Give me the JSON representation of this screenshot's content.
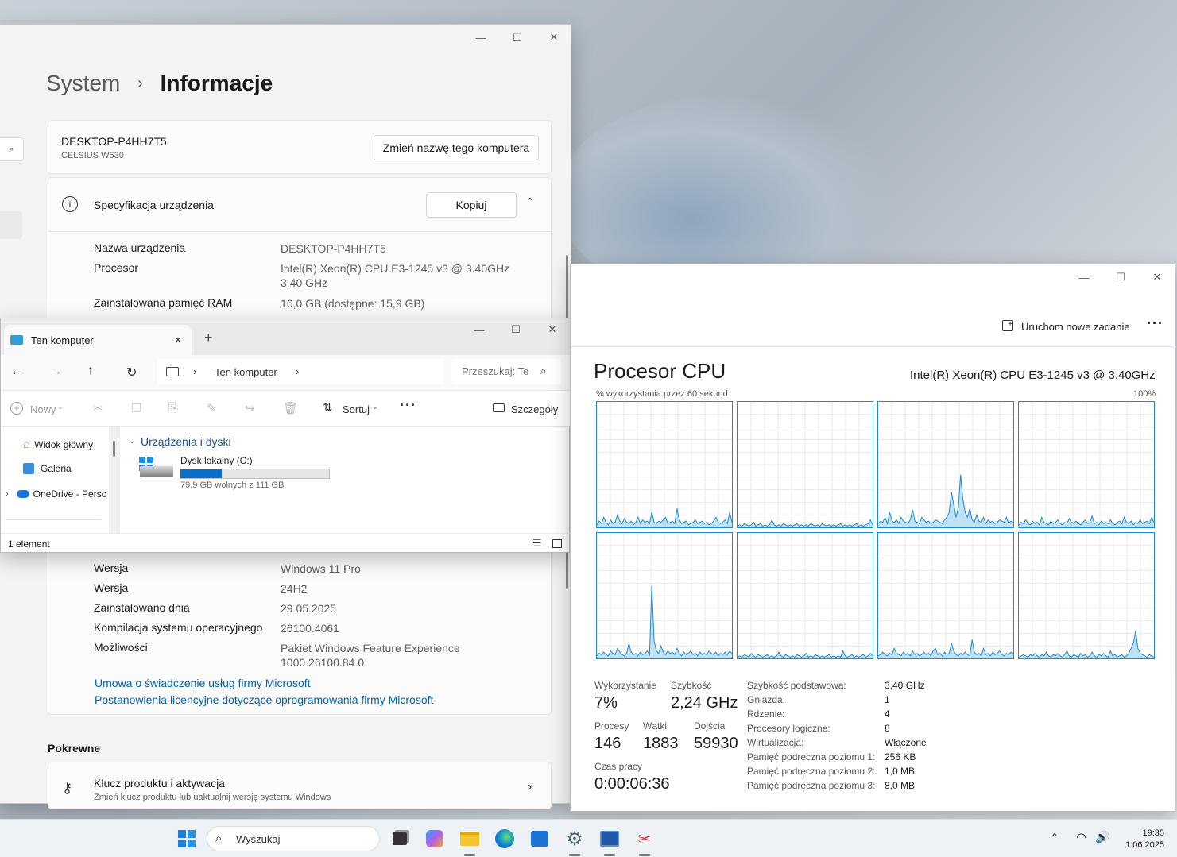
{
  "settings": {
    "breadcrumb_parent": "System",
    "breadcrumb_sep": "›",
    "title": "Informacje",
    "computer_name": "DESKTOP-P4HH7T5",
    "computer_model": "CELSIUS W530",
    "rename_button": "Zmień nazwę tego komputera",
    "spec_section_title": "Specyfikacja urządzenia",
    "copy_button": "Kopiuj",
    "device_specs": [
      {
        "key": "Nazwa urządzenia",
        "value": "DESKTOP-P4HH7T5"
      },
      {
        "key": "Procesor",
        "value": "Intel(R) Xeon(R) CPU E3-1245 v3 @ 3.40GHz",
        "value2": "3.40 GHz"
      },
      {
        "key": "Zainstalowana pamięć RAM",
        "value": "16,0 GB (dostępne: 15,9 GB)"
      }
    ],
    "windows_specs": [
      {
        "key": "Wersja",
        "value": "Windows 11 Pro"
      },
      {
        "key": "Wersja",
        "value": "24H2"
      },
      {
        "key": "Zainstalowano dnia",
        "value": "29.05.2025"
      },
      {
        "key": "Kompilacja systemu operacyjnego",
        "value": "26100.4061"
      },
      {
        "key": "Możliwości",
        "value": "Pakiet Windows Feature Experience",
        "value2": "1000.26100.84.0"
      }
    ],
    "link_services": "Umowa o świadczenie usług firmy Microsoft",
    "link_license": "Postanowienia licencyjne dotyczące oprogramowania firmy Microsoft",
    "related_heading": "Pokrewne",
    "product_key_title": "Klucz produktu i aktywacja",
    "product_key_desc": "Zmień klucz produktu lub uaktualnij wersję systemu Windows"
  },
  "explorer": {
    "tab_title": "Ten komputer",
    "breadcrumb": "Ten komputer",
    "search_placeholder": "Przeszukaj: Te",
    "cmd_new": "Nowy",
    "cmd_sort": "Sortuj",
    "cmd_details": "Szczegóły",
    "nav_items": [
      "Widok główny",
      "Galeria",
      "OneDrive - Perso"
    ],
    "group_title": "Urządzenia i dyski",
    "drive_name": "Dysk lokalny (C:)",
    "drive_free_text": "79,9 GB wolnych z 111 GB",
    "drive_used_fraction": 0.28,
    "status": "1 element"
  },
  "taskman": {
    "new_task": "Uruchom nowe zadanie",
    "heading": "Procesor CPU",
    "cpu_model": "Intel(R) Xeon(R) CPU E3-1245 v3 @ 3.40GHz",
    "graph_caption": "% wykorzystania przez 60 sekund",
    "graph_max": "100%",
    "stats": {
      "util_label": "Wykorzystanie",
      "util_value": "7%",
      "speed_label": "Szybkość",
      "speed_value": "2,24 GHz",
      "proc_label": "Procesy",
      "proc_value": "146",
      "threads_label": "Wątki",
      "threads_value": "1883",
      "handles_label": "Dojścia",
      "handles_value": "59930",
      "uptime_label": "Czas pracy",
      "uptime_value": "0:00:06:36"
    },
    "specs": [
      {
        "k": "Szybkość podstawowa:",
        "v": "3,40 GHz"
      },
      {
        "k": "Gniazda:",
        "v": "1"
      },
      {
        "k": "Rdzenie:",
        "v": "4"
      },
      {
        "k": "Procesory logiczne:",
        "v": "8"
      },
      {
        "k": "Wirtualizacja:",
        "v": "Włączone"
      },
      {
        "k": "Pamięć podręczna poziomu 1:",
        "v": "256 KB"
      },
      {
        "k": "Pamięć podręczna poziomu 2:",
        "v": "1,0 MB"
      },
      {
        "k": "Pamięć podręczna poziomu 3:",
        "v": "8,0 MB"
      }
    ],
    "cpu_graphs": [
      [
        2,
        5,
        3,
        8,
        4,
        2,
        6,
        3,
        4,
        10,
        5,
        3,
        7,
        4,
        3,
        5,
        2,
        4,
        8,
        3,
        6,
        4,
        5,
        3,
        12,
        4,
        3,
        5,
        4,
        6,
        8,
        3,
        4,
        5,
        3,
        15,
        6,
        3,
        4,
        5,
        2,
        3,
        4,
        6,
        3,
        4,
        5,
        3,
        4,
        2,
        3,
        5,
        8,
        4,
        3,
        4,
        6,
        3,
        12,
        4
      ],
      [
        1,
        2,
        1,
        3,
        2,
        1,
        2,
        4,
        1,
        2,
        3,
        1,
        2,
        1,
        2,
        6,
        2,
        1,
        2,
        1,
        3,
        2,
        1,
        2,
        1,
        2,
        3,
        1,
        2,
        1,
        2,
        1,
        3,
        2,
        1,
        2,
        1,
        3,
        2,
        1,
        2,
        1,
        2,
        1,
        2,
        3,
        1,
        2,
        1,
        2,
        1,
        2,
        3,
        1,
        2,
        1,
        2,
        3,
        6,
        2
      ],
      [
        3,
        5,
        4,
        8,
        3,
        12,
        5,
        4,
        6,
        3,
        8,
        5,
        4,
        3,
        6,
        14,
        5,
        4,
        3,
        8,
        6,
        4,
        5,
        3,
        4,
        6,
        5,
        4,
        3,
        6,
        8,
        12,
        28,
        18,
        8,
        16,
        42,
        22,
        12,
        8,
        15,
        6,
        4,
        10,
        5,
        4,
        8,
        3,
        6,
        4,
        5,
        3,
        4,
        6,
        5,
        4,
        8,
        3,
        5,
        4
      ],
      [
        2,
        4,
        3,
        6,
        3,
        2,
        5,
        3,
        4,
        2,
        8,
        4,
        3,
        2,
        5,
        3,
        4,
        6,
        3,
        2,
        4,
        3,
        7,
        4,
        3,
        5,
        3,
        2,
        4,
        6,
        3,
        4,
        9,
        3,
        4,
        2,
        5,
        3,
        4,
        3,
        6,
        3,
        2,
        4,
        5,
        3,
        8,
        4,
        3,
        5,
        2,
        4,
        3,
        6,
        3,
        4,
        5,
        3,
        8,
        4
      ],
      [
        2,
        4,
        3,
        5,
        3,
        2,
        6,
        4,
        3,
        8,
        5,
        3,
        2,
        4,
        12,
        5,
        3,
        4,
        2,
        5,
        3,
        4,
        6,
        3,
        58,
        14,
        6,
        4,
        10,
        5,
        3,
        6,
        4,
        5,
        3,
        8,
        4,
        2,
        5,
        3,
        4,
        6,
        3,
        4,
        2,
        5,
        3,
        4,
        3,
        6,
        4,
        3,
        5,
        2,
        4,
        3,
        5,
        3,
        6,
        4
      ],
      [
        1,
        2,
        1,
        3,
        2,
        1,
        4,
        2,
        1,
        3,
        2,
        1,
        2,
        3,
        1,
        2,
        1,
        2,
        5,
        2,
        1,
        3,
        2,
        1,
        2,
        1,
        3,
        2,
        1,
        2,
        4,
        1,
        2,
        1,
        3,
        2,
        1,
        2,
        1,
        2,
        3,
        1,
        2,
        1,
        2,
        1,
        6,
        2,
        1,
        2,
        3,
        1,
        2,
        1,
        2,
        3,
        1,
        2,
        4,
        2
      ],
      [
        2,
        3,
        5,
        3,
        2,
        4,
        3,
        8,
        4,
        3,
        2,
        5,
        3,
        4,
        2,
        6,
        3,
        4,
        2,
        3,
        5,
        3,
        4,
        2,
        6,
        8,
        3,
        4,
        2,
        5,
        3,
        4,
        12,
        6,
        3,
        2,
        4,
        3,
        5,
        3,
        2,
        15,
        5,
        3,
        4,
        2,
        8,
        3,
        4,
        2,
        5,
        3,
        4,
        6,
        3,
        2,
        4,
        3,
        5,
        4
      ],
      [
        1,
        2,
        3,
        2,
        1,
        3,
        2,
        4,
        2,
        1,
        3,
        2,
        5,
        2,
        1,
        3,
        2,
        4,
        2,
        1,
        3,
        6,
        2,
        1,
        3,
        2,
        1,
        4,
        2,
        3,
        1,
        2,
        5,
        2,
        1,
        3,
        2,
        4,
        2,
        1,
        6,
        2,
        3,
        1,
        2,
        3,
        1,
        2,
        4,
        8,
        12,
        22,
        8,
        4,
        3,
        2,
        1,
        3,
        2,
        1
      ]
    ]
  },
  "taskbar": {
    "search_placeholder": "Wyszukaj",
    "time": "19:35",
    "date": "1.06.2025"
  },
  "colors": {
    "accent": "#0067c0",
    "graph_line": "#1f88c9",
    "graph_fill": "#bfe3f6",
    "link": "#0063b1"
  }
}
